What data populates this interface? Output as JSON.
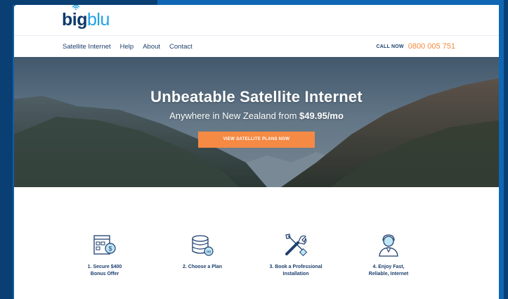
{
  "brand": {
    "logo_big": "big",
    "logo_blu": "blu"
  },
  "nav": {
    "items": [
      "Satellite Internet",
      "Help",
      "About",
      "Contact"
    ],
    "call_label": "CALL NOW",
    "call_number": "0800 005 751"
  },
  "hero": {
    "title": "Unbeatable Satellite Internet",
    "subtitle_prefix": "Anywhere in New Zealand from ",
    "subtitle_price": "$49.95/mo",
    "cta_label": "VIEW SATELLITE PLANS NOW"
  },
  "steps": [
    {
      "line1": "1. Secure $400",
      "line2": "Bonus Offer",
      "icon": "bonus-offer-icon"
    },
    {
      "line1": "2. Choose a Plan",
      "line2": "",
      "icon": "database-plan-icon"
    },
    {
      "line1": "3. Book a Professional",
      "line2": "Installation",
      "icon": "tools-icon"
    },
    {
      "line1": "4. Enjoy Fast,",
      "line2": "Reliable, Internet",
      "icon": "support-person-icon"
    }
  ],
  "colors": {
    "accent": "#f58a45",
    "brand_dark": "#0e3a6d",
    "brand_light": "#1da1e6",
    "frame_blue": "#0f66b3"
  }
}
